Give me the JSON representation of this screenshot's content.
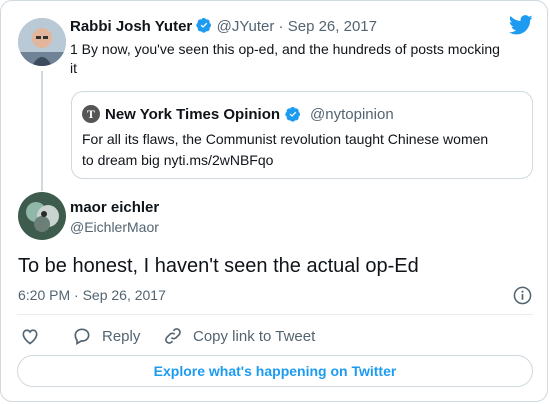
{
  "parent_tweet": {
    "author_name": "Rabbi Josh Yuter",
    "handle": "@JYuter",
    "separator": "·",
    "date": "Sep 26, 2017",
    "text_line1": "1 By now, you've seen this op-ed, and the hundreds of posts mocking",
    "text_line2": "it"
  },
  "quoted_tweet": {
    "author_name": "New York Times Opinion",
    "handle": "@nytopinion",
    "text_line1": "For all its flaws, the Communist revolution taught Chinese women",
    "text_line2": "to dream big nyti.ms/2wNBFqo"
  },
  "main_tweet": {
    "author_name": "maor eichler",
    "handle": "@EichlerMaor",
    "text": "To be honest, I haven't seen the actual op-Ed",
    "timestamp": "6:20 PM · Sep 26, 2017"
  },
  "actions": {
    "reply_label": "Reply",
    "copy_link_label": "Copy link to Tweet"
  },
  "explore_label": "Explore what's happening on Twitter",
  "colors": {
    "accent": "#1d9bf0",
    "border": "#cfd9de",
    "muted_text": "#536471"
  },
  "icons": [
    "twitter-bird-icon",
    "verified-badge-icon",
    "nyt-logo-icon",
    "info-icon",
    "heart-icon",
    "reply-icon",
    "link-icon"
  ]
}
